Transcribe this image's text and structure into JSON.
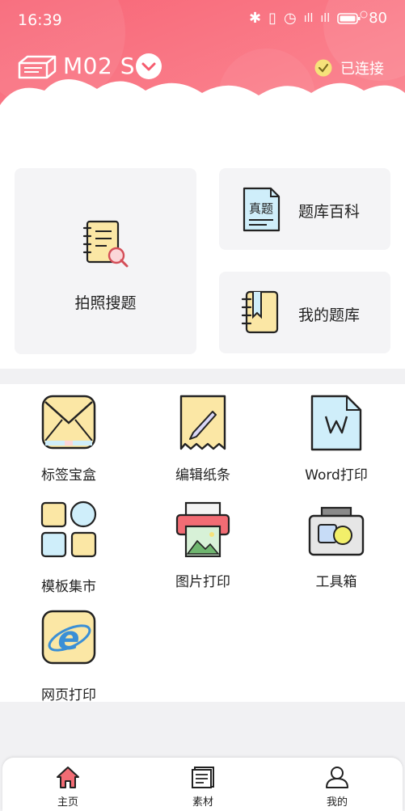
{
  "status_bar": {
    "time": "16:39",
    "battery": "80"
  },
  "device": {
    "name": "M02 S",
    "status": "已连接"
  },
  "cards": {
    "photo_search": "拍照搜题",
    "question_encyclopedia": "题库百科",
    "question_icon_text": "真题",
    "my_questions": "我的题库"
  },
  "tools": [
    {
      "label": "标签宝盒"
    },
    {
      "label": "编辑纸条"
    },
    {
      "label": "Word打印"
    },
    {
      "label": "模板集市"
    },
    {
      "label": "图片打印"
    },
    {
      "label": "工具箱"
    },
    {
      "label": "网页打印"
    }
  ],
  "tabs": [
    {
      "label": "主页",
      "active": true
    },
    {
      "label": "素材",
      "active": false
    },
    {
      "label": "我的",
      "active": false
    }
  ],
  "colors": {
    "brand": "#f65b6e",
    "header_light": "#fa8b97",
    "active_tab": "#f26c74"
  }
}
